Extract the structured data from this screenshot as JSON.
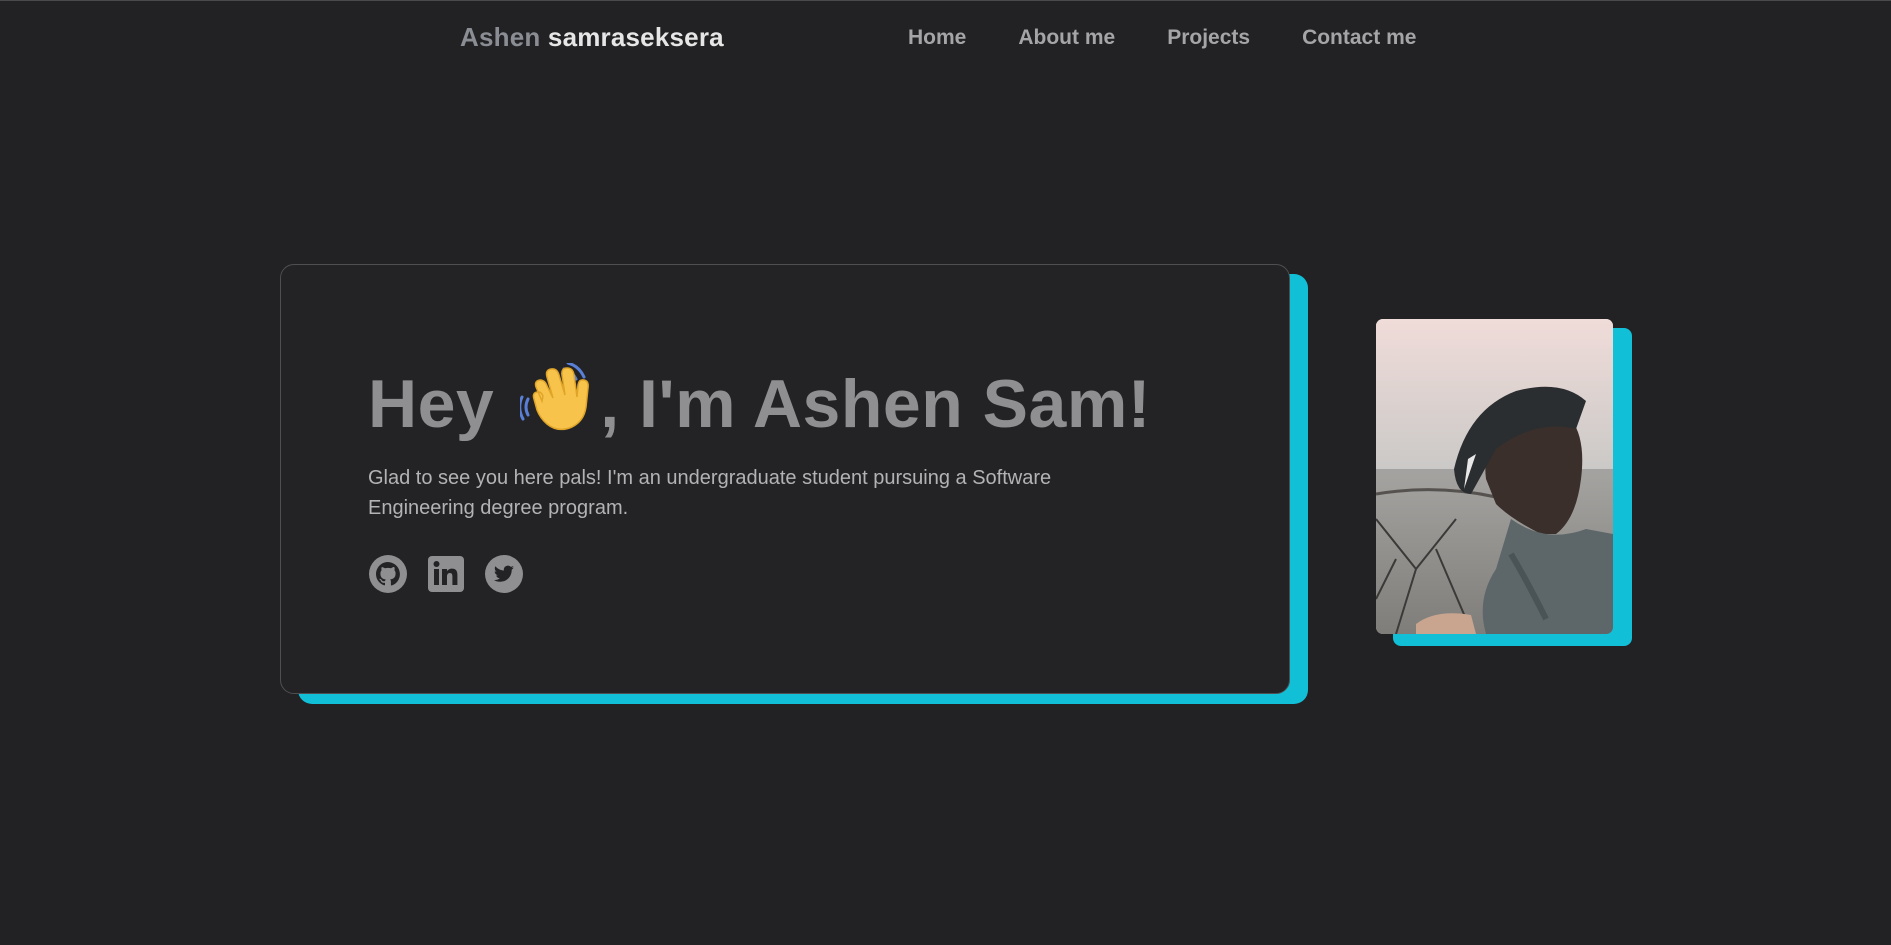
{
  "header": {
    "brand_first": "Ashen",
    "brand_last": "samraseksera",
    "nav": [
      {
        "label": "Home"
      },
      {
        "label": "About me"
      },
      {
        "label": "Projects"
      },
      {
        "label": "Contact me"
      }
    ]
  },
  "hero": {
    "title_before": "Hey",
    "title_after": ", I'm Ashen Sam!",
    "emoji": "waving-hand",
    "description": "Glad to see you here pals! I'm an undergraduate student pursuing a Software Engineering degree program.",
    "socials": [
      {
        "icon": "github-icon"
      },
      {
        "icon": "linkedin-icon"
      },
      {
        "icon": "twitter-icon"
      }
    ]
  },
  "colors": {
    "background": "#222224",
    "accent": "#11bfd6",
    "heading": "#8f8f91",
    "nav": "#a5a5a7"
  },
  "photo": {
    "subject": "profile photo"
  }
}
